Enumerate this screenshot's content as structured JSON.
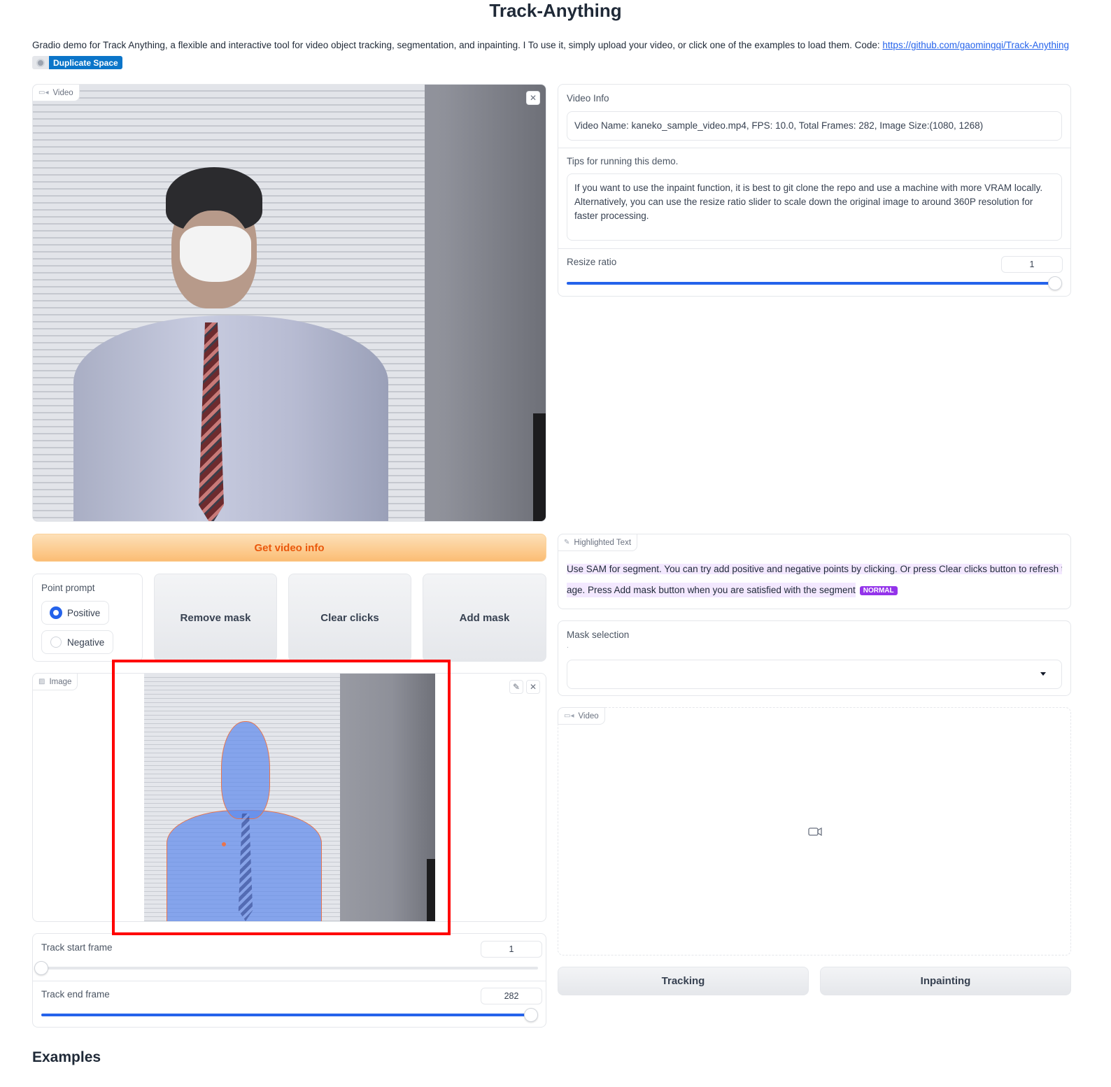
{
  "title": "Track-Anything",
  "description": "Gradio demo for Track Anything, a flexible and interactive tool for video object tracking, segmentation, and inpainting. I To use it, simply upload your video, or click one of the examples to load them. Code: ",
  "code_link": "https://github.com/gaomingqi/Track-Anything",
  "duplicate_label": "Duplicate Space",
  "video_input": {
    "badge": "Video",
    "close": "✕"
  },
  "get_video_info_label": "Get video info",
  "point_prompt": {
    "label": "Point prompt",
    "options": [
      "Positive",
      "Negative"
    ],
    "selected": "Positive"
  },
  "buttons": {
    "remove_mask": "Remove mask",
    "clear_clicks": "Clear clicks",
    "add_mask": "Add mask",
    "tracking": "Tracking",
    "inpainting": "Inpainting"
  },
  "image_output": {
    "badge": "Image",
    "edit": "✎",
    "close": "✕"
  },
  "track_start": {
    "label": "Track start frame",
    "value": "1",
    "fraction": 0.0
  },
  "track_end": {
    "label": "Track end frame",
    "value": "282",
    "fraction": 1.0
  },
  "video_info": {
    "label": "Video Info",
    "value": "Video Name: kaneko_sample_video.mp4, FPS: 10.0, Total Frames: 282, Image Size:(1080, 1268)"
  },
  "tips": {
    "label": "Tips for running this demo.",
    "value": "If you want to use the inpaint function, it is best to git clone the repo and use a machine with more VRAM locally. Alternatively, you can use the resize ratio slider to scale down the original image to around 360P resolution for faster processing."
  },
  "resize_ratio": {
    "label": "Resize ratio",
    "value": "1",
    "fraction": 1.0
  },
  "highlighted": {
    "badge": "Highlighted Text",
    "line1": "Use SAM for segment. You can try add positive and negative points by clicking. Or press Clear clicks button to refresh the im",
    "line2": "age. Press Add mask button when you are satisfied with the segment",
    "tag": "NORMAL"
  },
  "mask_selection": {
    "label": "Mask selection",
    "hint": ".",
    "value": ""
  },
  "video_output": {
    "badge": "Video"
  },
  "examples_heading": "Examples",
  "colors": {
    "accent": "#2563eb",
    "orange_button_text": "#ea580c",
    "highlight_tag": "#9333ea",
    "annotation_box": "#ff0000"
  }
}
